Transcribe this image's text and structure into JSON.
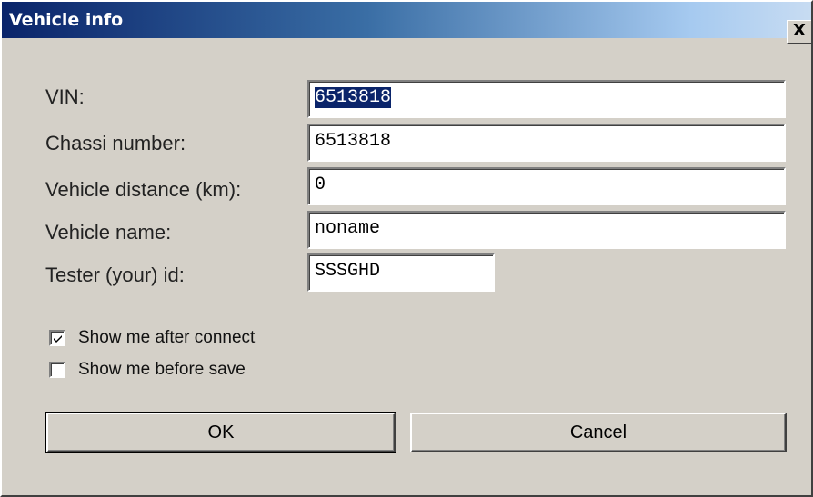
{
  "window": {
    "title": "Vehicle info",
    "close_glyph": "X"
  },
  "form": {
    "vin": {
      "label": "VIN:",
      "value": "6513818"
    },
    "chassi": {
      "label": "Chassi number:",
      "value": "6513818"
    },
    "distance": {
      "label": "Vehicle distance  (km):",
      "value": "0"
    },
    "name": {
      "label": "Vehicle name:",
      "value": "noname"
    },
    "tester": {
      "label": "Tester (your) id:",
      "value": "SSSGHD"
    }
  },
  "options": {
    "show_after_connect": {
      "label": "Show me after connect",
      "checked": true
    },
    "show_before_save": {
      "label": "Show me before save",
      "checked": false
    }
  },
  "buttons": {
    "ok": "OK",
    "cancel": "Cancel"
  }
}
